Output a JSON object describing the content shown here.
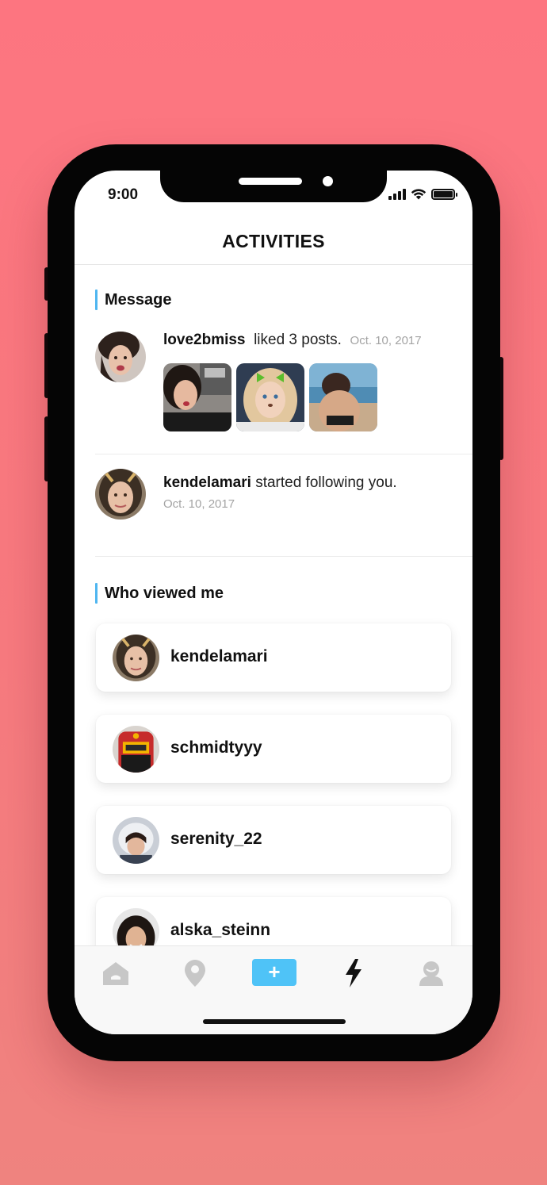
{
  "status_bar": {
    "time": "9:00"
  },
  "header": {
    "title": "ACTIVITIES"
  },
  "message_section": {
    "title": "Message",
    "items": [
      {
        "username": "love2bmiss",
        "action": "liked 3 posts.",
        "date": "Oct. 10, 2017"
      },
      {
        "username": "kendelamari",
        "action": "started following you.",
        "date": "Oct. 10, 2017"
      }
    ]
  },
  "viewers_section": {
    "title": "Who viewed me",
    "viewers": [
      {
        "username": "kendelamari"
      },
      {
        "username": "schmidtyyy"
      },
      {
        "username": "serenity_22"
      },
      {
        "username": "alska_steinn"
      }
    ]
  },
  "tabbar": {
    "items": [
      {
        "icon": "home-icon"
      },
      {
        "icon": "location-pin-icon"
      },
      {
        "icon": "plus-icon",
        "label": "+"
      },
      {
        "icon": "lightning-icon",
        "active": true
      },
      {
        "icon": "profile-icon"
      }
    ]
  },
  "colors": {
    "background": "#fd7580",
    "accent": "#4fb6f0",
    "plus_button": "#4fc3f7"
  }
}
